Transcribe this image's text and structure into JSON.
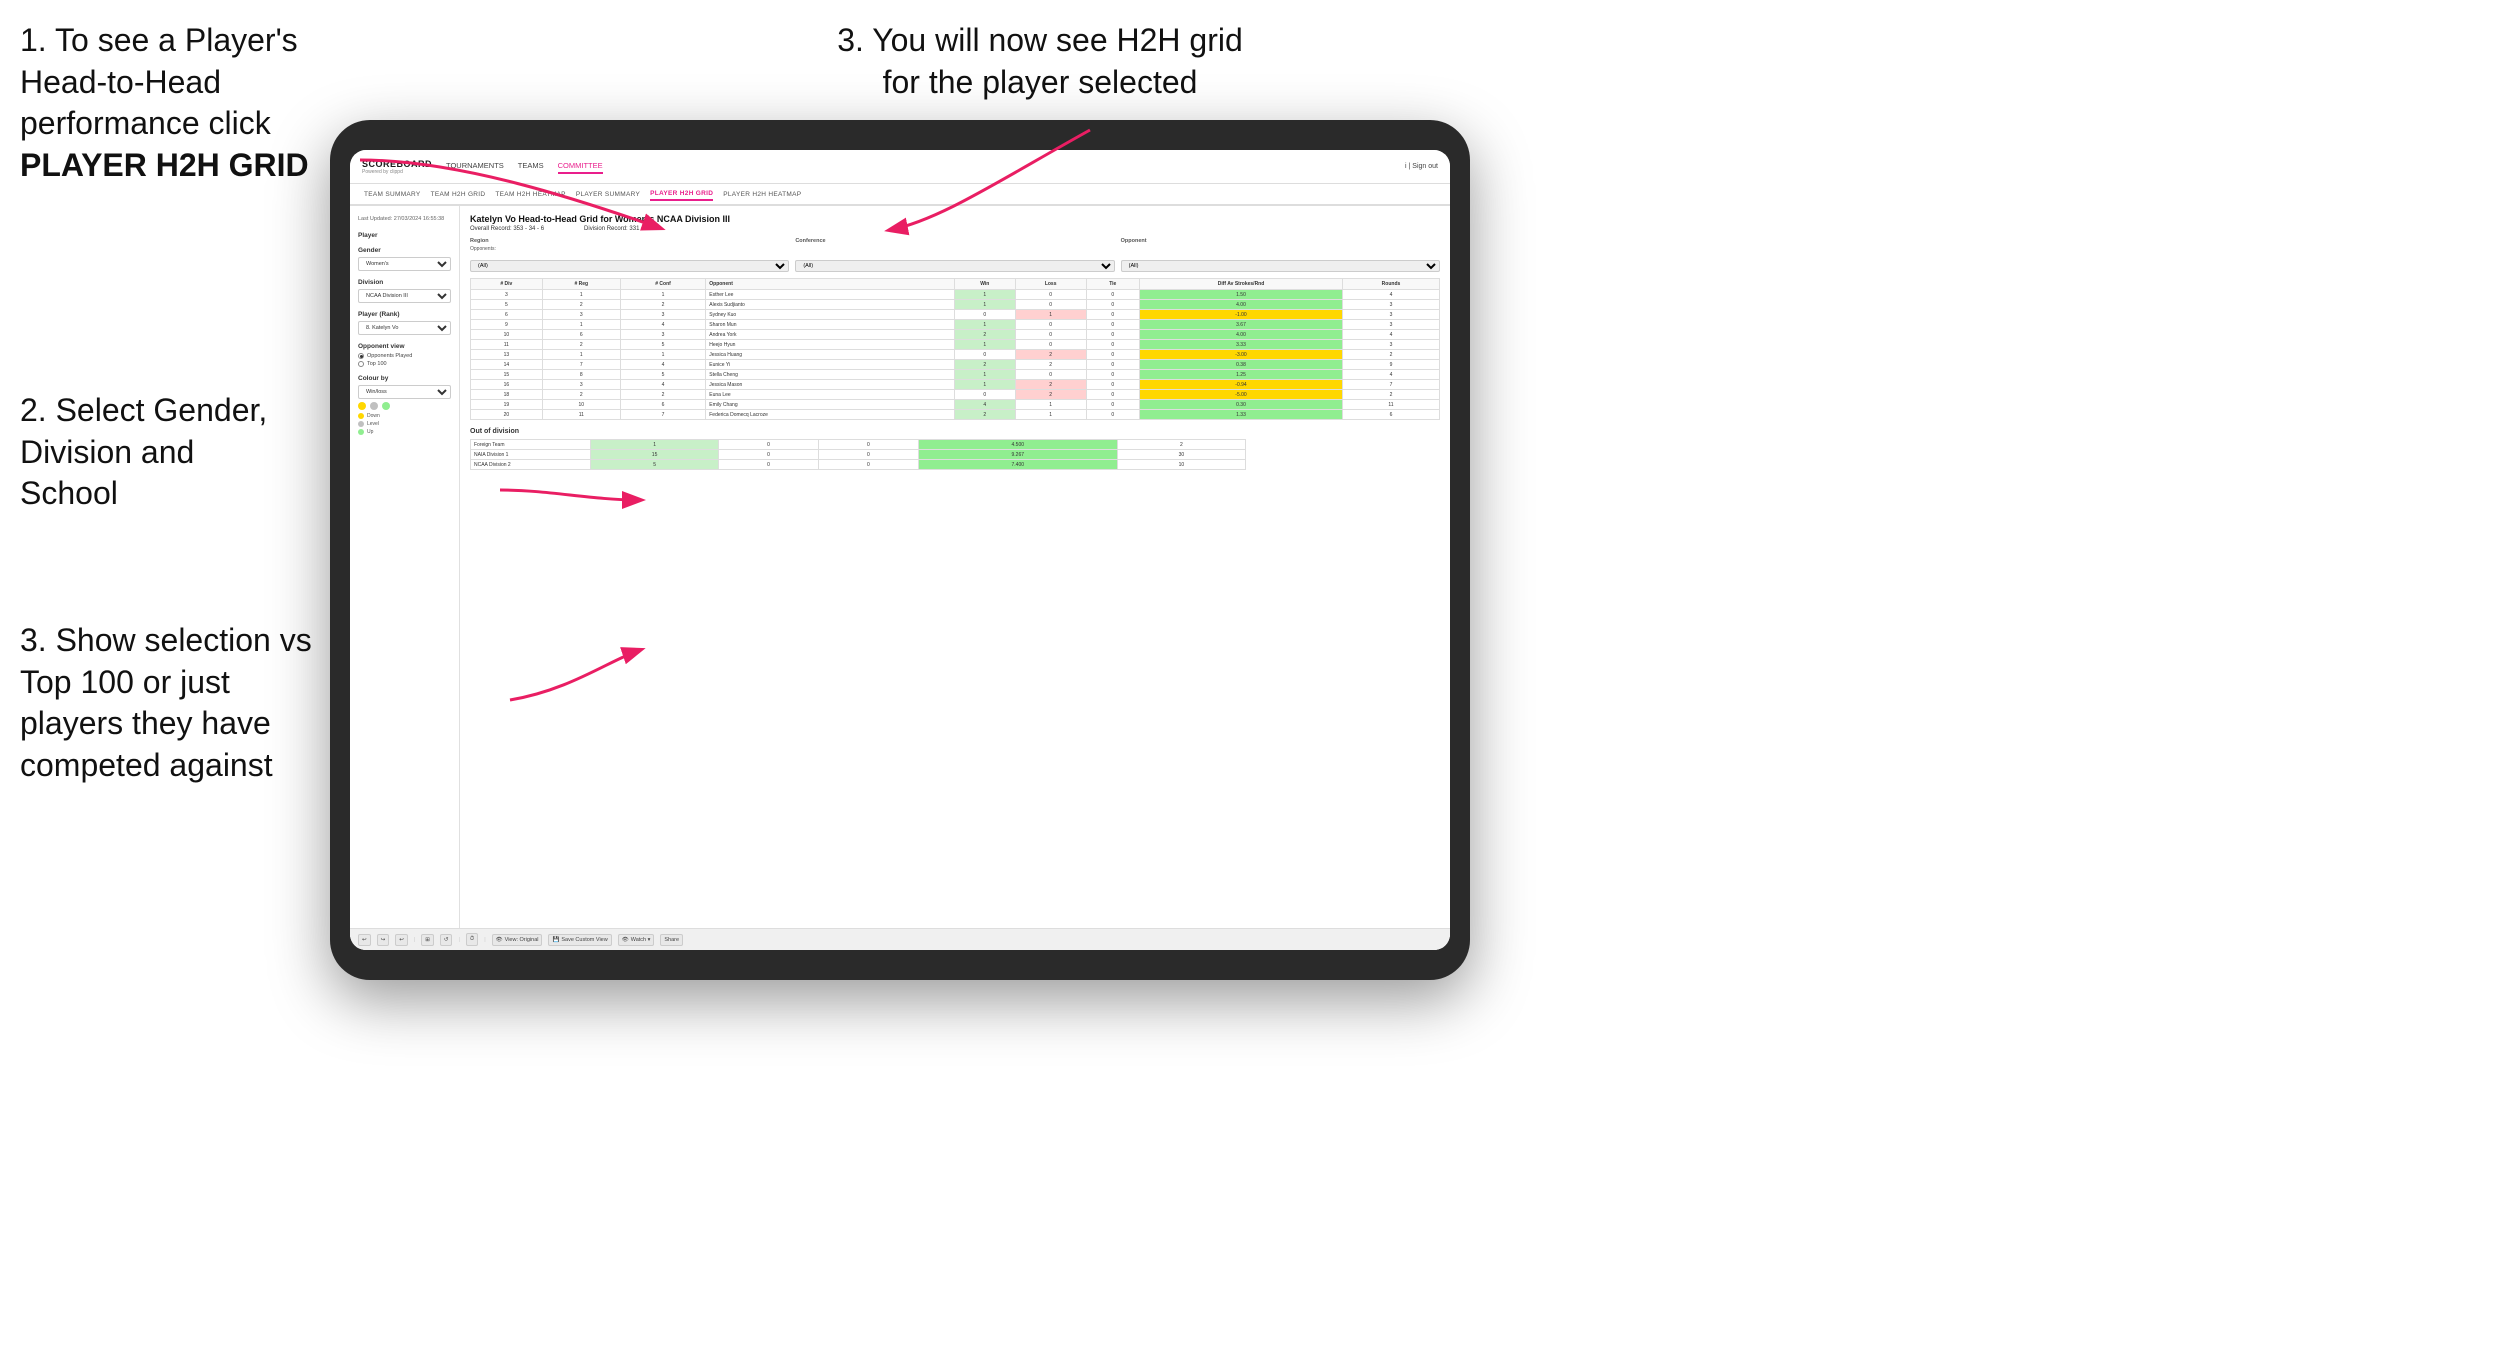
{
  "instructions": {
    "step1_title": "1. To see a Player's Head-to-Head performance click",
    "step1_bold": "PLAYER H2H GRID",
    "step2": "2. Select Gender, Division and School",
    "step3_top": "3. You will now see H2H grid for the player selected",
    "step3_bottom": "3. Show selection vs Top 100 or just players they have competed against"
  },
  "nav": {
    "logo": "SCOREBOARD",
    "logo_sub": "Powered by clippd",
    "links": [
      "TOURNAMENTS",
      "TEAMS",
      "COMMITTEE"
    ],
    "right": "i | Sign out",
    "active": "COMMITTEE"
  },
  "sub_nav": {
    "links": [
      "TEAM SUMMARY",
      "TEAM H2H GRID",
      "TEAM H2H HEATMAP",
      "PLAYER SUMMARY",
      "PLAYER H2H GRID",
      "PLAYER H2H HEATMAP"
    ],
    "active": "PLAYER H2H GRID"
  },
  "sidebar": {
    "timestamp": "Last Updated: 27/03/2024 16:55:38",
    "player_label": "Player",
    "gender_label": "Gender",
    "gender_value": "Women's",
    "division_label": "Division",
    "division_value": "NCAA Division III",
    "player_rank_label": "Player (Rank)",
    "player_rank_value": "8. Katelyn Vo",
    "opponent_view_label": "Opponent view",
    "radio_opponents": "Opponents Played",
    "radio_top100": "Top 100",
    "colour_label": "Colour by",
    "colour_value": "Win/loss",
    "colour_dots": [
      "#FFD700",
      "#C0C0C0",
      "#90EE90"
    ],
    "colour_legend": [
      "Down",
      "Level",
      "Up"
    ]
  },
  "main": {
    "title": "Katelyn Vo Head-to-Head Grid for Women's NCAA Division III",
    "overall_record": "Overall Record: 353 - 34 - 6",
    "division_record": "Division Record: 331 - 34 - 6",
    "region_label": "Region",
    "conference_label": "Conference",
    "opponent_label": "Opponent",
    "opponents_label": "Opponents:",
    "filter_all": "(All)",
    "columns": [
      "# Div",
      "# Reg",
      "# Conf",
      "Opponent",
      "Win",
      "Loss",
      "Tie",
      "Diff Av Strokes/Rnd",
      "Rounds"
    ],
    "rows": [
      {
        "div": "3",
        "reg": "1",
        "conf": "1",
        "opponent": "Esther Lee",
        "win": 1,
        "loss": 0,
        "tie": 0,
        "diff": "1.50",
        "rounds": 4,
        "win_color": "green"
      },
      {
        "div": "5",
        "reg": "2",
        "conf": "2",
        "opponent": "Alexis Sudjianto",
        "win": 1,
        "loss": 0,
        "tie": 0,
        "diff": "4.00",
        "rounds": 3,
        "win_color": "green"
      },
      {
        "div": "6",
        "reg": "3",
        "conf": "3",
        "opponent": "Sydney Kuo",
        "win": 0,
        "loss": 1,
        "tie": 0,
        "diff": "-1.00",
        "rounds": 3,
        "loss_color": "red"
      },
      {
        "div": "9",
        "reg": "1",
        "conf": "4",
        "opponent": "Sharon Mun",
        "win": 1,
        "loss": 0,
        "tie": 0,
        "diff": "3.67",
        "rounds": 3,
        "win_color": "green"
      },
      {
        "div": "10",
        "reg": "6",
        "conf": "3",
        "opponent": "Andrea York",
        "win": 2,
        "loss": 0,
        "tie": 0,
        "diff": "4.00",
        "rounds": 4,
        "win_color": "green"
      },
      {
        "div": "11",
        "reg": "2",
        "conf": "5",
        "opponent": "Heejo Hyun",
        "win": 1,
        "loss": 0,
        "tie": 0,
        "diff": "3.33",
        "rounds": 3,
        "win_color": "green"
      },
      {
        "div": "13",
        "reg": "1",
        "conf": "1",
        "opponent": "Jessica Huang",
        "win": 0,
        "loss": 2,
        "tie": 0,
        "diff": "-3.00",
        "rounds": 2,
        "loss_color": "red"
      },
      {
        "div": "14",
        "reg": "7",
        "conf": "4",
        "opponent": "Eunice Yi",
        "win": 2,
        "loss": 2,
        "tie": 0,
        "diff": "0.38",
        "rounds": 9,
        "tie_color": "yellow"
      },
      {
        "div": "15",
        "reg": "8",
        "conf": "5",
        "opponent": "Stella Cheng",
        "win": 1,
        "loss": 0,
        "tie": 0,
        "diff": "1.25",
        "rounds": 4,
        "win_color": "green"
      },
      {
        "div": "16",
        "reg": "3",
        "conf": "4",
        "opponent": "Jessica Mason",
        "win": 1,
        "loss": 2,
        "tie": 0,
        "diff": "-0.94",
        "rounds": 7,
        "loss_color": "red"
      },
      {
        "div": "18",
        "reg": "2",
        "conf": "2",
        "opponent": "Euna Lee",
        "win": 0,
        "loss": 2,
        "tie": 0,
        "diff": "-5.00",
        "rounds": 2,
        "loss_color": "red"
      },
      {
        "div": "19",
        "reg": "10",
        "conf": "6",
        "opponent": "Emily Chang",
        "win": 4,
        "loss": 1,
        "tie": 0,
        "diff": "0.30",
        "rounds": 11,
        "win_color": "green"
      },
      {
        "div": "20",
        "reg": "11",
        "conf": "7",
        "opponent": "Federica Domecq Lacroze",
        "win": 2,
        "loss": 1,
        "tie": 0,
        "diff": "1.33",
        "rounds": 6,
        "win_color": "green"
      }
    ],
    "out_of_division_title": "Out of division",
    "out_of_division_rows": [
      {
        "name": "Foreign Team",
        "win": 1,
        "loss": 0,
        "tie": 0,
        "diff": "4.500",
        "rounds": 2
      },
      {
        "name": "NAIA Division 1",
        "win": 15,
        "loss": 0,
        "tie": 0,
        "diff": "9.267",
        "rounds": 30
      },
      {
        "name": "NCAA Division 2",
        "win": 5,
        "loss": 0,
        "tie": 0,
        "diff": "7.400",
        "rounds": 10
      }
    ]
  },
  "toolbar": {
    "undo": "↩",
    "redo": "↪",
    "view_original": "View: Original",
    "save_custom": "Save Custom View",
    "watch": "Watch ▾",
    "share": "Share"
  }
}
